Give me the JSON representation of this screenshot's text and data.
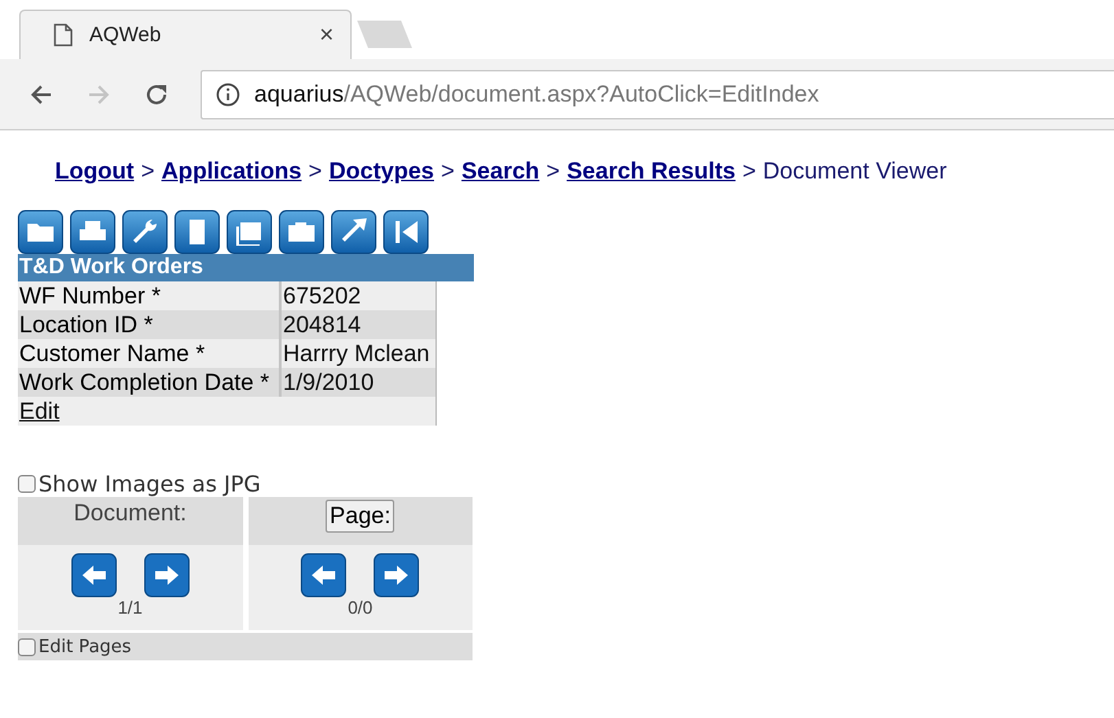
{
  "browser": {
    "tab_title": "AQWeb",
    "close": "×",
    "url_host": "aquarius",
    "url_path": "/AQWeb/document.aspx?AutoClick=EditIndex"
  },
  "breadcrumb": {
    "links": [
      "Logout",
      "Applications",
      "Doctypes",
      "Search",
      "Search Results"
    ],
    "separator": ">",
    "current": "Document Viewer"
  },
  "record": {
    "title": "T&D Work Orders",
    "fields": [
      {
        "label": "WF Number *",
        "value": "675202"
      },
      {
        "label": "Location ID *",
        "value": "204814"
      },
      {
        "label": "Customer Name *",
        "value": "Harrry Mclean"
      },
      {
        "label": "Work Completion Date *",
        "value": "1/9/2010"
      }
    ],
    "edit_link": "Edit"
  },
  "show_jpg": {
    "label": "Show Images as JPG",
    "checked": false
  },
  "navigator": {
    "document": {
      "label": "Document:",
      "count": "1/1"
    },
    "page": {
      "label": "Page:",
      "count": "0/0"
    }
  },
  "edit_pages": {
    "label": "Edit Pages",
    "checked": false
  }
}
